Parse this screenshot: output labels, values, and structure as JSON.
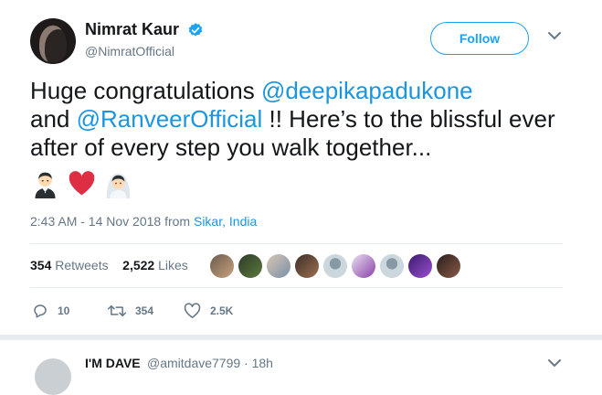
{
  "author": {
    "name": "Nimrat Kaur",
    "handle": "@NimratOfficial"
  },
  "follow_label": "Follow",
  "tweet": {
    "text_1": "Huge congratulations ",
    "mention_1": "@deepikapadukone",
    "text_2": "and ",
    "mention_2": "@RanveerOfficial",
    "text_3": " !! Here’s to the blissful ever after of every step you walk together...",
    "emojis": [
      "groom-emoji",
      "red-heart-emoji",
      "bride-with-veil-emoji"
    ]
  },
  "meta": {
    "timestamp": "2:43 AM - 14 Nov 2018 from ",
    "location": "Sikar, India"
  },
  "stats": {
    "retweets_count": "354",
    "retweets_label": "Retweets",
    "likes_count": "2,522",
    "likes_label": "Likes"
  },
  "actions": {
    "replies": "10",
    "retweets": "354",
    "likes": "2.5K"
  },
  "reply_preview": {
    "name": "I'M DAVE",
    "handle": "@amitdave7799 · 18h"
  },
  "colors": {
    "accent": "#1da1f2",
    "link": "#1b95e0",
    "muted": "#657786",
    "text": "#14171a"
  }
}
